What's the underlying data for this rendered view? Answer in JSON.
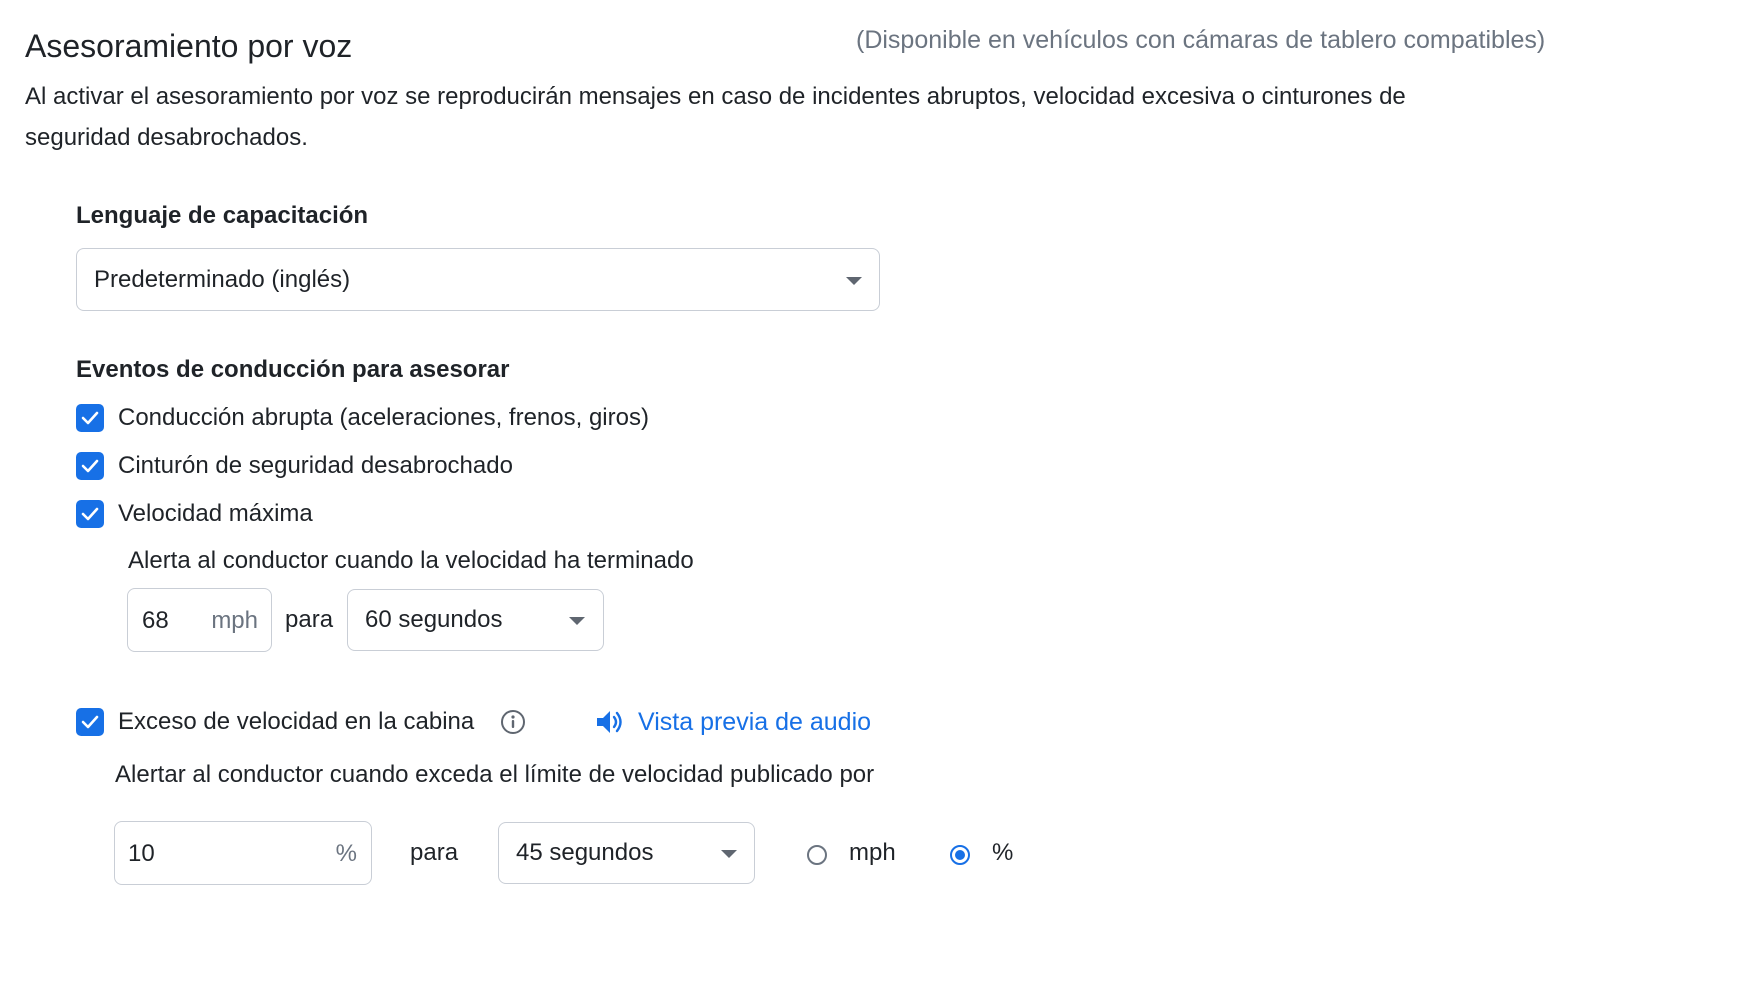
{
  "header": {
    "title": "Asesoramiento por voz",
    "availability_note": "(Disponible en vehículos con cámaras de tablero compatibles)",
    "description": "Al activar el asesoramiento por voz se reproducirán mensajes en caso de incidentes abruptos, velocidad excesiva o cinturones de seguridad desabrochados."
  },
  "language": {
    "heading": "Lenguaje de capacitación",
    "selected": "Predeterminado (inglés)"
  },
  "events": {
    "heading": "Eventos de conducción para asesorar",
    "items": [
      {
        "label": "Conducción abrupta (aceleraciones, frenos, giros)",
        "checked": true
      },
      {
        "label": "Cinturón de seguridad desabrochado",
        "checked": true
      },
      {
        "label": "Velocidad máxima",
        "checked": true
      }
    ]
  },
  "max_speed": {
    "alert_text": "Alerta al conductor cuando la velocidad ha terminado",
    "speed_value": "68",
    "speed_unit": "mph",
    "para_label": "para",
    "duration_selected": "60 segundos"
  },
  "cabin_speeding": {
    "label": "Exceso de velocidad en la cabina",
    "checked": true,
    "audio_preview_label": "Vista previa de audio",
    "alert_text": "Alertar al conductor cuando exceda el límite de velocidad publicado por",
    "threshold_value": "10",
    "threshold_unit": "%",
    "para_label": "para",
    "duration_selected": "45 segundos",
    "unit_options": [
      {
        "label": "mph",
        "selected": false
      },
      {
        "label": "%",
        "selected": true
      }
    ]
  },
  "colors": {
    "accent": "#1770e6",
    "text": "#1f2328",
    "muted": "#6b7480",
    "border": "#c9ced6"
  }
}
